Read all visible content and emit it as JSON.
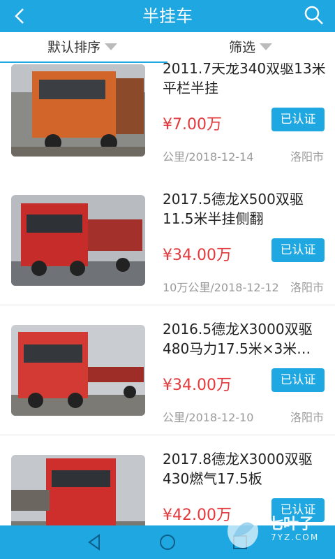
{
  "header": {
    "title": "半挂车"
  },
  "filters": {
    "sort_label": "默认排序",
    "filter_label": "筛选"
  },
  "listings": [
    {
      "title": "2011.7天龙340双驱13米平栏半挂",
      "price": "¥7.00万",
      "badge": "已认证",
      "meta": "公里/2018-12-14",
      "city": "洛阳市"
    },
    {
      "title": "2017.5德龙X500双驱11.5米半挂侧翻",
      "price": "¥34.00万",
      "badge": "已认证",
      "meta": "10万公里/2018-12-12",
      "city": "洛阳市"
    },
    {
      "title": "2016.5德龙X3000双驱480马力17.5米×3米…",
      "price": "¥34.00万",
      "badge": "已认证",
      "meta": "公里/2018-12-10",
      "city": "洛阳市"
    },
    {
      "title": "2017.8德龙X3000双驱430燃气17.5板",
      "price": "¥42.00万",
      "badge": "已认证",
      "meta": "",
      "city": ""
    }
  ],
  "watermark": {
    "brand": "七叶子",
    "domain": "7YZ.COM"
  },
  "colors": {
    "accent": "#1ea7e1",
    "price": "#e4393c"
  }
}
